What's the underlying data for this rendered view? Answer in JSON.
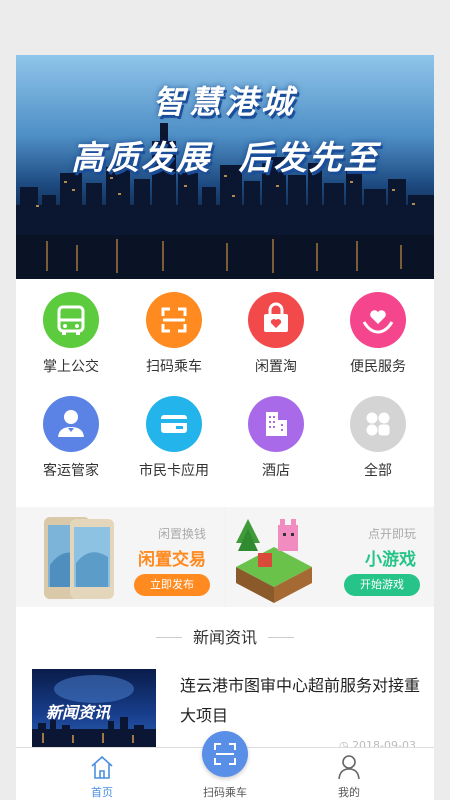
{
  "banner": {
    "title_line1": "智慧港城",
    "title_line2": "高质发展  后发先至"
  },
  "grid": {
    "items": [
      {
        "label": "掌上公交",
        "icon": "bus-icon",
        "color": "#5ccb3d"
      },
      {
        "label": "扫码乘车",
        "icon": "scan-icon",
        "color": "#ff8a1f"
      },
      {
        "label": "闲置淘",
        "icon": "gift-bag-icon",
        "color": "#f24a4a"
      },
      {
        "label": "便民服务",
        "icon": "heart-hand-icon",
        "color": "#f5468d"
      },
      {
        "label": "客运管家",
        "icon": "user-manager-icon",
        "color": "#5b83e6"
      },
      {
        "label": "市民卡应用",
        "icon": "card-icon",
        "color": "#22b4ea"
      },
      {
        "label": "酒店",
        "icon": "building-icon",
        "color": "#a86ae8"
      },
      {
        "label": "全部",
        "icon": "all-apps-icon",
        "color": "#d4d4d4"
      }
    ]
  },
  "promo": {
    "left": {
      "small": "闲置换钱",
      "big": "闲置交易",
      "button": "立即发布",
      "color": "#ff8a1f"
    },
    "right": {
      "small": "点开即玩",
      "big": "小游戏",
      "button": "开始游戏",
      "color": "#27c48a"
    }
  },
  "news": {
    "header": "新闻资讯",
    "items": [
      {
        "thumb_text": "新闻资讯",
        "title": "连云港市图审中心超前服务对接重大项目",
        "date": "2018-09-03"
      }
    ]
  },
  "tabbar": {
    "home": "首页",
    "scan": "扫码乘车",
    "mine": "我的",
    "active_color": "#4a8fe0"
  }
}
